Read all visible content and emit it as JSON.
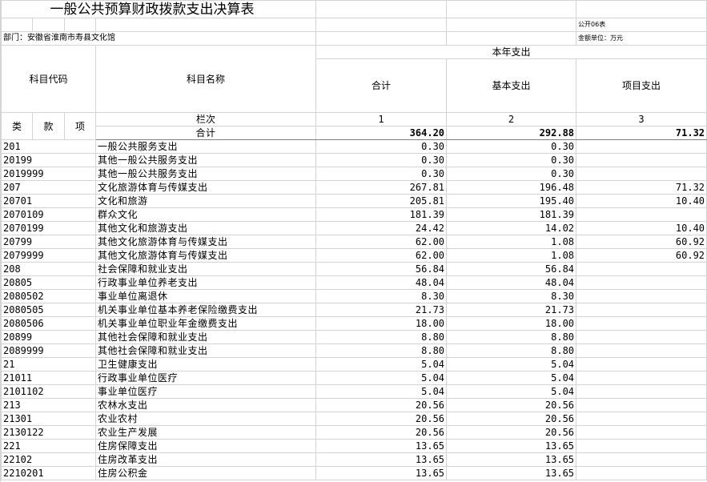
{
  "title": "一般公共预算财政拨款支出决算表",
  "form_no": "公开06表",
  "department": "部门：安徽省淮南市寿县文化馆",
  "unit": "金额单位：万元",
  "headers": {
    "code": "科目代码",
    "name": "科目名称",
    "year_expense": "本年支出",
    "total": "合计",
    "basic": "基本支出",
    "project": "项目支出",
    "col_index_label": "栏次",
    "col1": "1",
    "col2": "2",
    "col3": "3",
    "lei": "类",
    "kuan": "款",
    "xiang": "项"
  },
  "total_row": {
    "label": "合计",
    "total": "364.20",
    "basic": "292.88",
    "project": "71.32"
  },
  "rows": [
    {
      "code": "201",
      "name": "一般公共服务支出",
      "total": "0.30",
      "basic": "0.30",
      "project": ""
    },
    {
      "code": "20199",
      "name": "其他一般公共服务支出",
      "total": "0.30",
      "basic": "0.30",
      "project": ""
    },
    {
      "code": "2019999",
      "name": "其他一般公共服务支出",
      "total": "0.30",
      "basic": "0.30",
      "project": ""
    },
    {
      "code": "207",
      "name": "文化旅游体育与传媒支出",
      "total": "267.81",
      "basic": "196.48",
      "project": "71.32"
    },
    {
      "code": "20701",
      "name": "文化和旅游",
      "total": "205.81",
      "basic": "195.40",
      "project": "10.40"
    },
    {
      "code": "2070109",
      "name": "群众文化",
      "total": "181.39",
      "basic": "181.39",
      "project": ""
    },
    {
      "code": "2070199",
      "name": "其他文化和旅游支出",
      "total": "24.42",
      "basic": "14.02",
      "project": "10.40"
    },
    {
      "code": "20799",
      "name": "其他文化旅游体育与传媒支出",
      "total": "62.00",
      "basic": "1.08",
      "project": "60.92"
    },
    {
      "code": "2079999",
      "name": "其他文化旅游体育与传媒支出",
      "total": "62.00",
      "basic": "1.08",
      "project": "60.92"
    },
    {
      "code": "208",
      "name": "社会保障和就业支出",
      "total": "56.84",
      "basic": "56.84",
      "project": ""
    },
    {
      "code": "20805",
      "name": "行政事业单位养老支出",
      "total": "48.04",
      "basic": "48.04",
      "project": ""
    },
    {
      "code": "2080502",
      "name": "事业单位离退休",
      "total": "8.30",
      "basic": "8.30",
      "project": ""
    },
    {
      "code": "2080505",
      "name": "机关事业单位基本养老保险缴费支出",
      "total": "21.73",
      "basic": "21.73",
      "project": ""
    },
    {
      "code": "2080506",
      "name": "机关事业单位职业年金缴费支出",
      "total": "18.00",
      "basic": "18.00",
      "project": ""
    },
    {
      "code": "20899",
      "name": "其他社会保障和就业支出",
      "total": "8.80",
      "basic": "8.80",
      "project": ""
    },
    {
      "code": "2089999",
      "name": "其他社会保障和就业支出",
      "total": "8.80",
      "basic": "8.80",
      "project": ""
    },
    {
      "code": "21",
      "name": "卫生健康支出",
      "total": "5.04",
      "basic": "5.04",
      "project": ""
    },
    {
      "code": "21011",
      "name": "行政事业单位医疗",
      "total": "5.04",
      "basic": "5.04",
      "project": ""
    },
    {
      "code": "2101102",
      "name": "事业单位医疗",
      "total": "5.04",
      "basic": "5.04",
      "project": ""
    },
    {
      "code": "213",
      "name": "农林水支出",
      "total": "20.56",
      "basic": "20.56",
      "project": ""
    },
    {
      "code": "21301",
      "name": "农业农村",
      "total": "20.56",
      "basic": "20.56",
      "project": ""
    },
    {
      "code": "2130122",
      "name": "农业生产发展",
      "total": "20.56",
      "basic": "20.56",
      "project": ""
    },
    {
      "code": "221",
      "name": "住房保障支出",
      "total": "13.65",
      "basic": "13.65",
      "project": ""
    },
    {
      "code": "22102",
      "name": "住房改革支出",
      "total": "13.65",
      "basic": "13.65",
      "project": ""
    },
    {
      "code": "2210201",
      "name": "住房公积金",
      "total": "13.65",
      "basic": "13.65",
      "project": ""
    }
  ]
}
